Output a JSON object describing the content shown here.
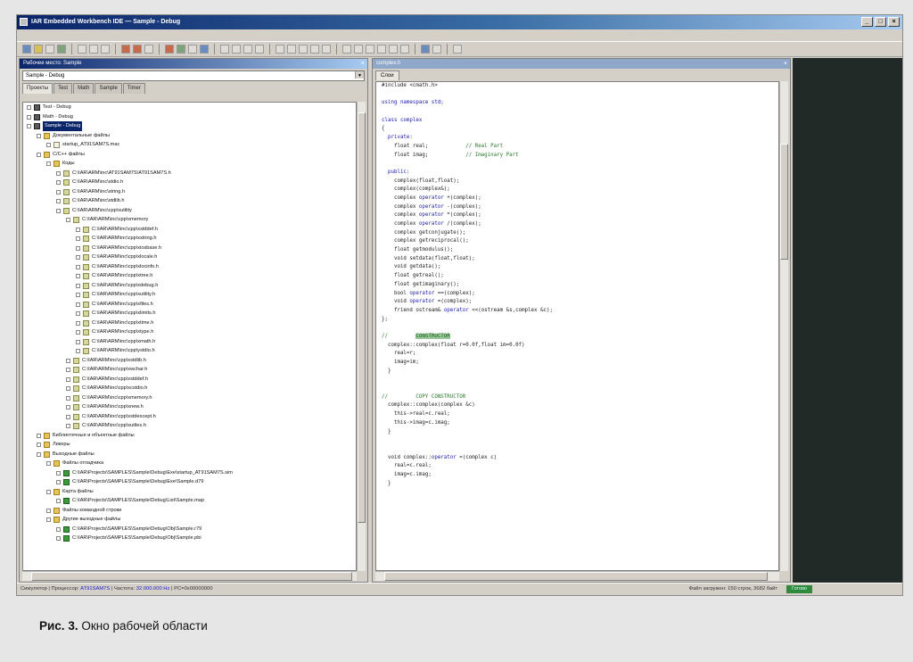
{
  "window": {
    "title": "IAR Embedded Workbench IDE — Sample - Debug"
  },
  "workspace": {
    "title": "Рабочее место: Sample",
    "config": "Sample - Debug",
    "tabs": [
      "Проекты",
      "Test",
      "Math",
      "Sample",
      "Timer"
    ],
    "tree": [
      {
        "label": "Test - Debug",
        "indent": 0,
        "icon": "proj"
      },
      {
        "label": "Math - Debug",
        "indent": 0,
        "icon": "proj"
      },
      {
        "label": "Sample - Debug",
        "indent": 0,
        "icon": "proj",
        "selected": true
      },
      {
        "label": "Документальные файлы",
        "indent": 1,
        "icon": "folder"
      },
      {
        "label": "startup_AT91SAM7S.mac",
        "indent": 2,
        "icon": "file"
      },
      {
        "label": "C/C++ файлы",
        "indent": 1,
        "icon": "folder"
      },
      {
        "label": "Коды",
        "indent": 2,
        "icon": "folder"
      },
      {
        "label": "C:\\IAR\\ARM\\inc\\AT91SAM7S\\AT91SAM7S.h",
        "indent": 3,
        "icon": "header"
      },
      {
        "label": "C:\\IAR\\ARM\\inc\\stdio.h",
        "indent": 3,
        "icon": "header"
      },
      {
        "label": "C:\\IAR\\ARM\\inc\\string.h",
        "indent": 3,
        "icon": "header"
      },
      {
        "label": "C:\\IAR\\ARM\\inc\\stdlib.h",
        "indent": 3,
        "icon": "header"
      },
      {
        "label": "C:\\IAR\\ARM\\inc\\cpp\\xutility",
        "indent": 3,
        "icon": "header"
      },
      {
        "label": "C:\\IAR\\ARM\\inc\\cpp\\xmemory",
        "indent": 4,
        "icon": "header"
      },
      {
        "label": "C:\\IAR\\ARM\\inc\\cpp\\xstddef.h",
        "indent": 5,
        "icon": "header"
      },
      {
        "label": "C:\\IAR\\ARM\\inc\\cpp\\xstring.h",
        "indent": 5,
        "icon": "header"
      },
      {
        "label": "C:\\IAR\\ARM\\inc\\cpp\\xiosbase.h",
        "indent": 5,
        "icon": "header"
      },
      {
        "label": "C:\\IAR\\ARM\\inc\\cpp\\xlocale.h",
        "indent": 5,
        "icon": "header"
      },
      {
        "label": "C:\\IAR\\ARM\\inc\\cpp\\xlocinfo.h",
        "indent": 5,
        "icon": "header"
      },
      {
        "label": "C:\\IAR\\ARM\\inc\\cpp\\xtree.h",
        "indent": 5,
        "icon": "header"
      },
      {
        "label": "C:\\IAR\\ARM\\inc\\cpp\\xdebug.h",
        "indent": 5,
        "icon": "header"
      },
      {
        "label": "C:\\IAR\\ARM\\inc\\cpp\\xutility.h",
        "indent": 5,
        "icon": "header"
      },
      {
        "label": "C:\\IAR\\ARM\\inc\\cpp\\xfiles.h",
        "indent": 5,
        "icon": "header"
      },
      {
        "label": "C:\\IAR\\ARM\\inc\\cpp\\xlimits.h",
        "indent": 5,
        "icon": "header"
      },
      {
        "label": "C:\\IAR\\ARM\\inc\\cpp\\xtime.h",
        "indent": 5,
        "icon": "header"
      },
      {
        "label": "C:\\IAR\\ARM\\inc\\cpp\\xtype.h",
        "indent": 5,
        "icon": "header"
      },
      {
        "label": "C:\\IAR\\ARM\\inc\\cpp\\xmath.h",
        "indent": 5,
        "icon": "header"
      },
      {
        "label": "C:\\IAR\\ARM\\inc\\cpp\\ystdio.h",
        "indent": 5,
        "icon": "header"
      },
      {
        "label": "C:\\IAR\\ARM\\inc\\cpp\\xstdlib.h",
        "indent": 4,
        "icon": "header"
      },
      {
        "label": "C:\\IAR\\ARM\\inc\\cpp\\xwchar.h",
        "indent": 4,
        "icon": "header"
      },
      {
        "label": "C:\\IAR\\ARM\\inc\\cpp\\xstddef.h",
        "indent": 4,
        "icon": "header"
      },
      {
        "label": "C:\\IAR\\ARM\\inc\\cpp\\xcstdio.h",
        "indent": 4,
        "icon": "header"
      },
      {
        "label": "C:\\IAR\\ARM\\inc\\cpp\\xmemory.h",
        "indent": 4,
        "icon": "header"
      },
      {
        "label": "C:\\IAR\\ARM\\inc\\cpp\\xnew.h",
        "indent": 4,
        "icon": "header"
      },
      {
        "label": "C:\\IAR\\ARM\\inc\\cpp\\xstdexcept.h",
        "indent": 4,
        "icon": "header"
      },
      {
        "label": "C:\\IAR\\ARM\\inc\\cpp\\xutilex.h",
        "indent": 4,
        "icon": "header"
      },
      {
        "label": "Библиотечные и объектные файлы",
        "indent": 1,
        "icon": "folder"
      },
      {
        "label": "Ликеры",
        "indent": 1,
        "icon": "folder"
      },
      {
        "label": "Выходные файлы",
        "indent": 1,
        "icon": "folder"
      },
      {
        "label": "Файлы отладчика",
        "indent": 2,
        "icon": "folder"
      },
      {
        "label": "C:\\IAR\\Projects\\SAMPLES\\Sample\\Debug\\Exe\\startup_AT91SAM7S.sim",
        "indent": 3,
        "icon": "bin"
      },
      {
        "label": "C:\\IAR\\Projects\\SAMPLES\\Sample\\Debug\\Exe\\Sample.d79",
        "indent": 3,
        "icon": "bin"
      },
      {
        "label": "Карта файлы",
        "indent": 2,
        "icon": "folder"
      },
      {
        "label": "C:\\IAR\\Projects\\SAMPLES\\Sample\\Debug\\List\\Sample.map",
        "indent": 3,
        "icon": "bin"
      },
      {
        "label": "Файлы командной строки",
        "indent": 2,
        "icon": "folder"
      },
      {
        "label": "Другие выходные файлы",
        "indent": 2,
        "icon": "folder"
      },
      {
        "label": "C:\\IAR\\Projects\\SAMPLES\\Sample\\Debug\\Obj\\Sample.r79",
        "indent": 3,
        "icon": "bin"
      },
      {
        "label": "C:\\IAR\\Projects\\SAMPLES\\Sample\\Debug\\Obj\\Sample.pbi",
        "indent": 3,
        "icon": "bin"
      }
    ]
  },
  "editor": {
    "title": "complex.h",
    "tab": "Слои",
    "code": [
      [
        {
          "t": "#include <cmath.h>",
          "c": ""
        }
      ],
      [
        {
          "t": "",
          "c": ""
        }
      ],
      [
        {
          "t": "using namespace std;",
          "c": "kw"
        }
      ],
      [
        {
          "t": "",
          "c": ""
        }
      ],
      [
        {
          "t": "class complex",
          "c": "kw"
        }
      ],
      [
        {
          "t": "{",
          "c": ""
        }
      ],
      [
        {
          "t": "  private:",
          "c": "kw"
        }
      ],
      [
        {
          "t": "    float real;            ",
          "c": ""
        },
        {
          "t": "// Real Part",
          "c": "cm"
        }
      ],
      [
        {
          "t": "    float imag;            ",
          "c": ""
        },
        {
          "t": "// Imaginary Part",
          "c": "cm"
        }
      ],
      [
        {
          "t": "",
          "c": ""
        }
      ],
      [
        {
          "t": "  public:",
          "c": "kw"
        }
      ],
      [
        {
          "t": "    complex(float,float);",
          "c": ""
        }
      ],
      [
        {
          "t": "    complex(complex&);",
          "c": ""
        }
      ],
      [
        {
          "t": "    complex ",
          "c": ""
        },
        {
          "t": "operator",
          "c": "kw"
        },
        {
          "t": " +(complex);",
          "c": ""
        }
      ],
      [
        {
          "t": "    complex ",
          "c": ""
        },
        {
          "t": "operator",
          "c": "kw"
        },
        {
          "t": " -(complex);",
          "c": ""
        }
      ],
      [
        {
          "t": "    complex ",
          "c": ""
        },
        {
          "t": "operator",
          "c": "kw"
        },
        {
          "t": " *(complex);",
          "c": ""
        }
      ],
      [
        {
          "t": "    complex ",
          "c": ""
        },
        {
          "t": "operator",
          "c": "kw"
        },
        {
          "t": " /(complex);",
          "c": ""
        }
      ],
      [
        {
          "t": "    complex getconjugate();",
          "c": ""
        }
      ],
      [
        {
          "t": "    complex getreciprocal();",
          "c": ""
        }
      ],
      [
        {
          "t": "    float getmodulus();",
          "c": ""
        }
      ],
      [
        {
          "t": "    void setdata(float,float);",
          "c": ""
        }
      ],
      [
        {
          "t": "    void getdata();",
          "c": ""
        }
      ],
      [
        {
          "t": "    float getreal();",
          "c": ""
        }
      ],
      [
        {
          "t": "    float getimaginary();",
          "c": ""
        }
      ],
      [
        {
          "t": "    bool ",
          "c": ""
        },
        {
          "t": "operator",
          "c": "kw"
        },
        {
          "t": " ==(complex);",
          "c": ""
        }
      ],
      [
        {
          "t": "    void ",
          "c": ""
        },
        {
          "t": "operator",
          "c": "kw"
        },
        {
          "t": " =(complex);",
          "c": ""
        }
      ],
      [
        {
          "t": "    friend ostream& ",
          "c": ""
        },
        {
          "t": "operator",
          "c": "kw"
        },
        {
          "t": " <<(ostream &s,complex &c);",
          "c": ""
        }
      ],
      [
        {
          "t": "};",
          "c": ""
        }
      ],
      [
        {
          "t": "",
          "c": ""
        }
      ],
      [
        {
          "t": "//         ",
          "c": "cm"
        },
        {
          "t": "CONSTRUCTOR",
          "c": "hl"
        }
      ],
      [
        {
          "t": "  complex::complex(float r=0.0f,float im=0.0f)",
          "c": ""
        }
      ],
      [
        {
          "t": "    real=r;",
          "c": ""
        }
      ],
      [
        {
          "t": "    imag=im;",
          "c": ""
        }
      ],
      [
        {
          "t": "  }",
          "c": ""
        }
      ],
      [
        {
          "t": "",
          "c": ""
        }
      ],
      [
        {
          "t": "",
          "c": ""
        }
      ],
      [
        {
          "t": "//         COPY CONSTRUCTOR",
          "c": "cm"
        }
      ],
      [
        {
          "t": "  complex::complex(complex &c)",
          "c": ""
        }
      ],
      [
        {
          "t": "    this->real=c.real;",
          "c": ""
        }
      ],
      [
        {
          "t": "    this->imag=c.imag;",
          "c": ""
        }
      ],
      [
        {
          "t": "  }",
          "c": ""
        }
      ],
      [
        {
          "t": "",
          "c": ""
        }
      ],
      [
        {
          "t": "",
          "c": ""
        }
      ],
      [
        {
          "t": "  void complex::",
          "c": ""
        },
        {
          "t": "operator",
          "c": "kw"
        },
        {
          "t": " =(complex c)",
          "c": ""
        }
      ],
      [
        {
          "t": "    real=c.real;",
          "c": ""
        }
      ],
      [
        {
          "t": "    imag=c.imag;",
          "c": ""
        }
      ],
      [
        {
          "t": "  }",
          "c": ""
        }
      ]
    ]
  },
  "status": {
    "left_a": "Симулятор | Процессор: ",
    "left_b": "AT91SAM7S",
    "left_c": " | Частота: ",
    "left_d": "32.000.000 Hz",
    "left_e": " | PC=0x00000000",
    "right": "Файл загружен: 150 строк, 3682 байт",
    "badge": "Готово"
  },
  "caption": {
    "bold": "Рис. 3.",
    "text": " Окно рабочей области"
  },
  "colors": {
    "titlebar": "#0a246a",
    "selection": "#0a246a",
    "keyword": "#1a1aa6",
    "comment": "#2a7a2a",
    "dark_pane": "#222a28"
  }
}
